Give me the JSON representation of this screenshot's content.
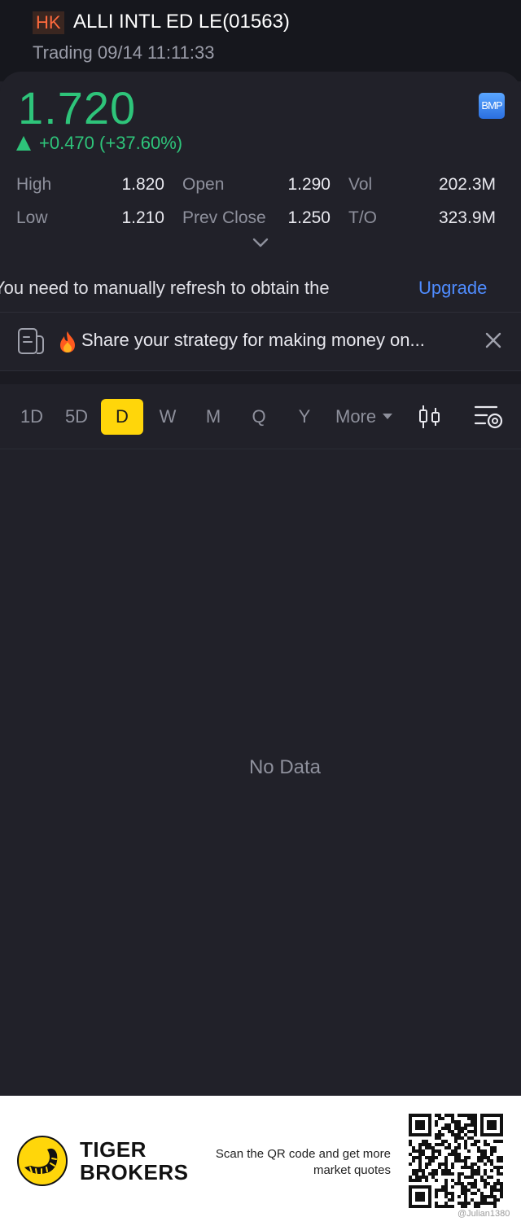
{
  "header": {
    "market": "HK",
    "title": "ALLI INTL ED LE(01563)",
    "status": "Trading 09/14 11:11:33"
  },
  "quote": {
    "price": "1.720",
    "change": "+0.470 (+37.60%)",
    "badge": "BMP",
    "up_color": "#2ec47a",
    "stats": {
      "high_label": "High",
      "high_value": "1.820",
      "open_label": "Open",
      "open_value": "1.290",
      "vol_label": "Vol",
      "vol_value": "202.3M",
      "low_label": "Low",
      "low_value": "1.210",
      "prev_close_label": "Prev Close",
      "prev_close_value": "1.250",
      "turnover_label": "T/O",
      "turnover_value": "323.9M"
    }
  },
  "notice": {
    "text": "You need to manually refresh to obtain the",
    "upgrade_label": "Upgrade"
  },
  "promo": {
    "text": "Share your strategy for making money on...",
    "icons": [
      "document-icon",
      "fire-icon",
      "close-icon"
    ]
  },
  "periods": {
    "tabs": [
      "1D",
      "5D",
      "D",
      "W",
      "M",
      "Q",
      "Y"
    ],
    "active": "D",
    "more_label": "More",
    "accent": "#ffd60a"
  },
  "chart": {
    "empty_text": "No Data"
  },
  "footer": {
    "brand_line1": "TIGER",
    "brand_line2": "BROKERS",
    "scan_line1": "Scan the QR code and get more",
    "scan_line2": "market quotes",
    "watermark": "@Julian1380"
  }
}
